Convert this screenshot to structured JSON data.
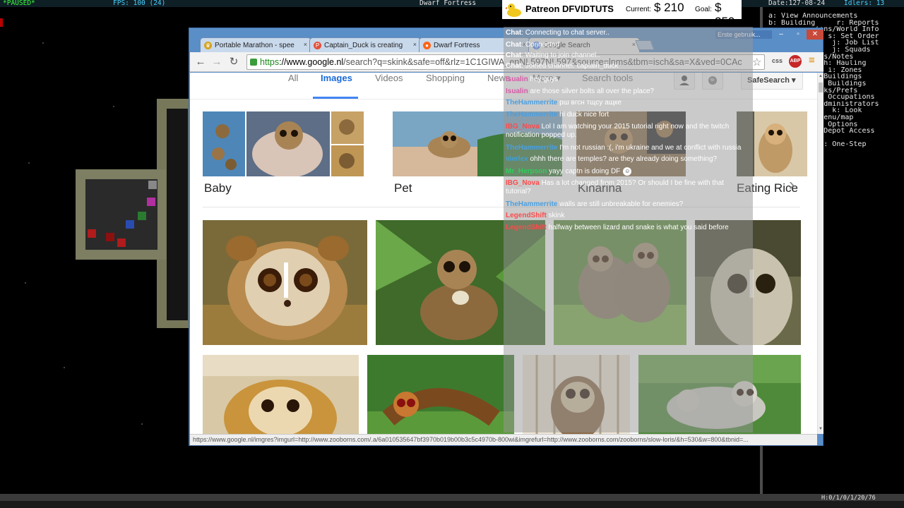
{
  "df": {
    "paused": "*PAUSED*",
    "fps": "FPS: 100 (24)",
    "title": "Dwarf Fortress",
    "date": "Date:127-08-24",
    "idlers": "Idlers: 13",
    "menu": [
      "a: View Announcements",
      "b: Building     r: Reports",
      "           ions/World Info",
      "           on s: Set Order",
      "               j: Job List",
      "               j: Squads",
      "          utes/Notes",
      "          ws h: Hauling",
      "          s   i: Zones",
      "          es/Buildings",
      "           in Buildings",
      "          Tasks/Prefs",
      "          and Occupations",
      "          d Administrators",
      "               k: Look",
      "          s menu/map",
      "          SC: Options",
      "          e: Depot Access",
      "",
      "          e .: One-Step"
    ],
    "status": "H:0/1/0/1/20/76",
    "colors": {
      "paused": "#3cff3c",
      "fps": "#48d0ff",
      "wall": "#7d7e62"
    }
  },
  "browser": {
    "user_chip": "Erste gebruik...",
    "tabs": [
      {
        "label": "Portable Marathon - spee",
        "favicon": "trophy-icon"
      },
      {
        "label": "Captain_Duck is creating",
        "favicon": "patreon-icon"
      },
      {
        "label": "Dwarf Fortress",
        "favicon": "reddit-icon"
      },
      {
        "label": "Google Search",
        "favicon": "google-icon"
      }
    ],
    "url_scheme": "https",
    "url_host": "://www.google.nl",
    "url_rest": "/search?q=skink&safe=off&rlz=1C1GIWA_enNL597NL597&source=lnms&tbm=isch&sa=X&ved=0CAc",
    "extensions": [
      "css",
      "ABP"
    ],
    "status_url": "https://www.google.nl/imgres?imgurl=http://www.zooborns.com/.a/6a010535647bf3970b019b00b3c5c4970b-800wi&imgrefurl=http://www.zooborns.com/zooborns/slow-loris/&h=530&w=800&tbnid=..."
  },
  "google": {
    "nav": [
      "All",
      "Images",
      "Videos",
      "Shopping",
      "News",
      "More ▾",
      "Search tools"
    ],
    "active_tab": "Images",
    "safesearch": "SafeSearch ▾",
    "related": [
      "Baby",
      "Pet",
      "Kinarina",
      "Eating Rice"
    ],
    "accent": "#4285f4"
  },
  "patreon": {
    "name": "Patreon DFVIDTUTS",
    "current_label": "Current:",
    "current_value": "$ 210",
    "goal_label": "Goal:",
    "goal_value": "$ 250"
  },
  "chat": {
    "messages": [
      {
        "name": "Chat",
        "text": ": Connecting to chat server..",
        "color": "#ffffff"
      },
      {
        "name": "Chat",
        "text": ": Connected",
        "color": "#ffffff"
      },
      {
        "name": "Chat",
        "text": ": Waiting to join channel..",
        "color": "#ffffff"
      },
      {
        "name": "Chat",
        "text": ": Joined channel: captain_duck",
        "color": "#ffffff"
      },
      {
        "name": "Isualin",
        "text": " hey guys",
        "color": "#d85aa8"
      },
      {
        "name": "Isualin",
        "text": " are those silver bolts all over the place?",
        "color": "#d85aa8"
      },
      {
        "name": "TheHammerrite",
        "text": " рш вгсн тщсу ащке",
        "color": "#4a9fe0"
      },
      {
        "name": "TheHammerrite",
        "text": " hi duck nice fort",
        "color": "#4a9fe0"
      },
      {
        "name": "IBG_Nova",
        "text": " Lol I am watching your 2015 tutorial right now and the twitch notification popped up.",
        "color": "#ff4a4a"
      },
      {
        "name": "TheHammerrite",
        "text": " I'm not russian :(, i'm ukraine and we at conflict with russia",
        "color": "#4a9fe0"
      },
      {
        "name": "vierlex",
        "text": " ohhh there are temples? are they already doing something?",
        "color": "#3da0d8"
      },
      {
        "name": "Mr_Herpson",
        "text": " yayy captn is doing DF",
        "color": "#2fce5a"
      },
      {
        "name": "IBG_Nova",
        "text": " Has a lot changed from 2015? Or should I be fine with that tutorial?",
        "color": "#ff4a4a"
      },
      {
        "name": "TheHammerrite",
        "text": " walls are still unbreakable for enemies?",
        "color": "#4a9fe0"
      },
      {
        "name": "LegendShift",
        "text": " skink",
        "color": "#ff4a4a"
      },
      {
        "name": "LegendShift",
        "text": " halfway between lizard and snake is what you said before",
        "color": "#ff4a4a"
      }
    ]
  }
}
